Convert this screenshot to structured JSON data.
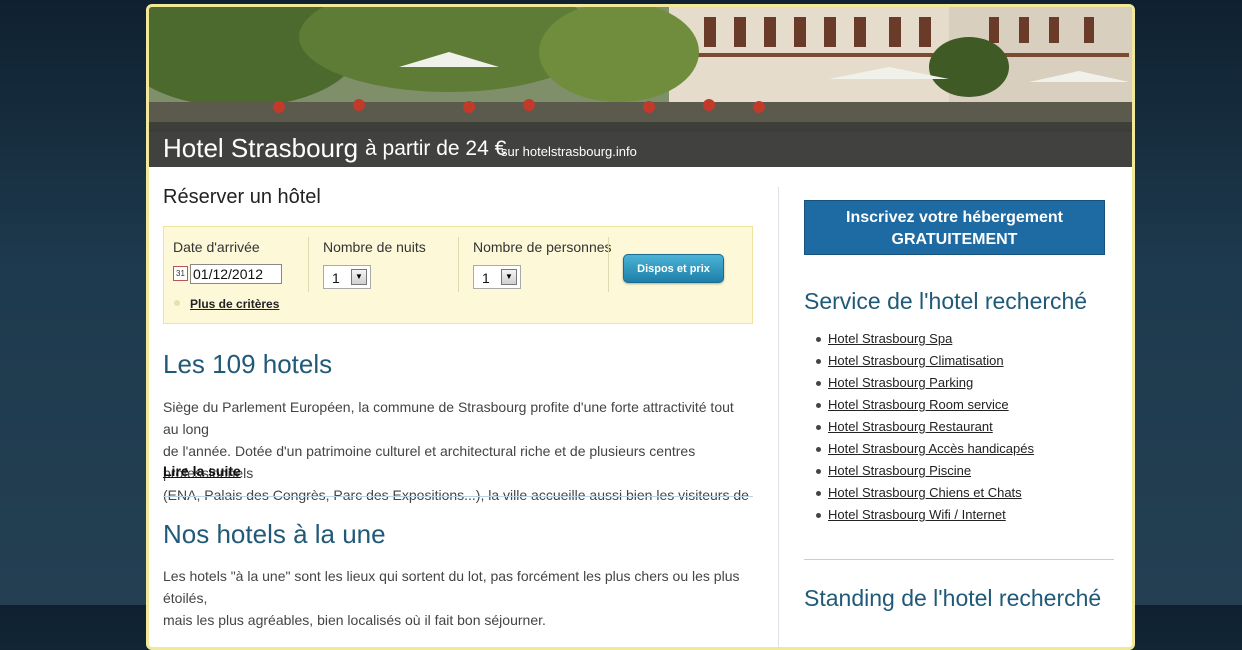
{
  "header": {
    "title_main": "Hotel Strasbourg",
    "title_price": "à partir de 24 €",
    "title_site": "sur hotelstrasbourg.info"
  },
  "booking": {
    "heading": "Réserver un hôtel",
    "arrival_label": "Date d'arrivée",
    "arrival_value": "01/12/2012",
    "calendar_icon_text": "31",
    "nights_label": "Nombre de nuits",
    "nights_value": "1",
    "persons_label": "Nombre de personnes",
    "persons_value": "1",
    "more_criteria": "Plus de critères",
    "submit_label": "Dispos et prix"
  },
  "hotels_section": {
    "heading": "Les 109 hotels",
    "text_lines": [
      "Siège du Parlement Européen, la commune de Strasbourg profite d'une forte attractivité tout au long",
      "de l'année. Dotée d'un patrimoine culturel et architectural riche et de plusieurs centres professionnels",
      "(ENA, Palais des Congrès, Parc des Expositions...), la ville accueille aussi bien les visiteurs de"
    ],
    "read_more": "Lire la suite"
  },
  "featured_section": {
    "heading": "Nos hotels à la une",
    "text_lines": [
      "Les hotels \"à la une\" sont les lieux qui sortent du lot, pas forcément les plus chers ou les plus étoilés,",
      "mais les plus agréables, bien localisés où il fait bon séjourner."
    ]
  },
  "sidebar": {
    "signup_line1": "Inscrivez votre hébergement",
    "signup_line2": "GRATUITEMENT",
    "service_heading": "Service de l'hotel recherché",
    "service_links": [
      "Hotel Strasbourg Spa",
      "Hotel Strasbourg Climatisation",
      "Hotel Strasbourg Parking",
      "Hotel Strasbourg Room service",
      "Hotel Strasbourg Restaurant",
      "Hotel Strasbourg Accès handicapés",
      "Hotel Strasbourg Piscine",
      "Hotel Strasbourg Chiens et Chats",
      "Hotel Strasbourg Wifi / Internet"
    ],
    "standing_heading": "Standing de l'hotel recherché"
  },
  "colors": {
    "accent_blue": "#1e6ba3",
    "heading_blue": "#205a78",
    "form_bg": "#fdf8d8",
    "button_teal": "#2a96c2"
  }
}
